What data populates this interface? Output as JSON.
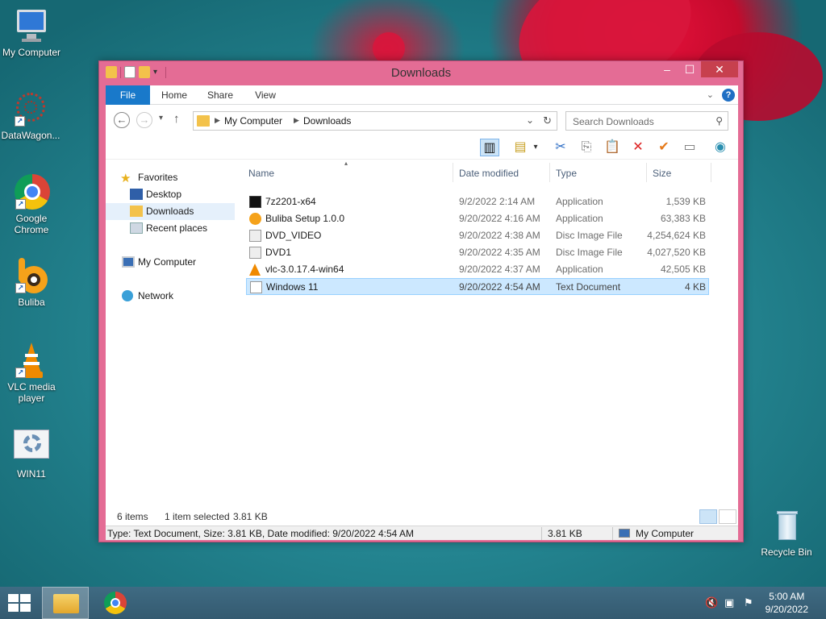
{
  "desktop": {
    "icons": [
      {
        "label": "My Computer"
      },
      {
        "label": "DataWagon..."
      },
      {
        "label": "Google Chrome"
      },
      {
        "label": "Buliba"
      },
      {
        "label": "VLC media player"
      },
      {
        "label": "WIN11"
      },
      {
        "label": "Recycle Bin"
      }
    ]
  },
  "window": {
    "title": "Downloads",
    "controls": {
      "minimize": "–",
      "maximize": "☐",
      "close": "✕"
    }
  },
  "ribbon": {
    "tabs": [
      "File",
      "Home",
      "Share",
      "View"
    ],
    "help": "?"
  },
  "navbar": {
    "back": "←",
    "forward": "→",
    "up": "↑",
    "breadcrumb": [
      "My Computer",
      "Downloads"
    ],
    "search_placeholder": "Search Downloads"
  },
  "navpane": {
    "favorites": "Favorites",
    "items": [
      "Desktop",
      "Downloads",
      "Recent places"
    ],
    "computer": "My Computer",
    "network": "Network"
  },
  "filelist": {
    "columns": [
      "Name",
      "Date modified",
      "Type",
      "Size"
    ],
    "rows": [
      {
        "name": "7z2201-x64",
        "date": "9/2/2022 2:14 AM",
        "type": "Application",
        "size": "1,539 KB",
        "icon": "7zip-icon",
        "selected": false
      },
      {
        "name": "Buliba Setup 1.0.0",
        "date": "9/20/2022 4:16 AM",
        "type": "Application",
        "size": "63,383 KB",
        "icon": "buliba-icon",
        "selected": false
      },
      {
        "name": "DVD_VIDEO",
        "date": "9/20/2022 4:38 AM",
        "type": "Disc Image File",
        "size": "4,254,624 KB",
        "icon": "disc-icon",
        "selected": false
      },
      {
        "name": "DVD1",
        "date": "9/20/2022 4:35 AM",
        "type": "Disc Image File",
        "size": "4,027,520 KB",
        "icon": "disc-icon",
        "selected": false
      },
      {
        "name": "vlc-3.0.17.4-win64",
        "date": "9/20/2022 4:37 AM",
        "type": "Application",
        "size": "42,505 KB",
        "icon": "vlc-icon",
        "selected": false
      },
      {
        "name": "Windows 11",
        "date": "9/20/2022 4:54 AM",
        "type": "Text Document",
        "size": "4 KB",
        "icon": "text-file-icon",
        "selected": true
      }
    ]
  },
  "countbar": {
    "items": "6 items",
    "selected": "1 item selected",
    "selected_size": "3.81 KB"
  },
  "statusbar": {
    "details": "Type: Text Document, Size: 3.81 KB, Date modified: 9/20/2022 4:54 AM",
    "size": "3.81 KB",
    "location": "My Computer"
  },
  "taskbar": {
    "time": "5:00 AM",
    "date": "9/20/2022"
  },
  "colors": {
    "window_frame": "#e46c95",
    "file_tab": "#1979ca",
    "selection": "#cce8ff"
  }
}
